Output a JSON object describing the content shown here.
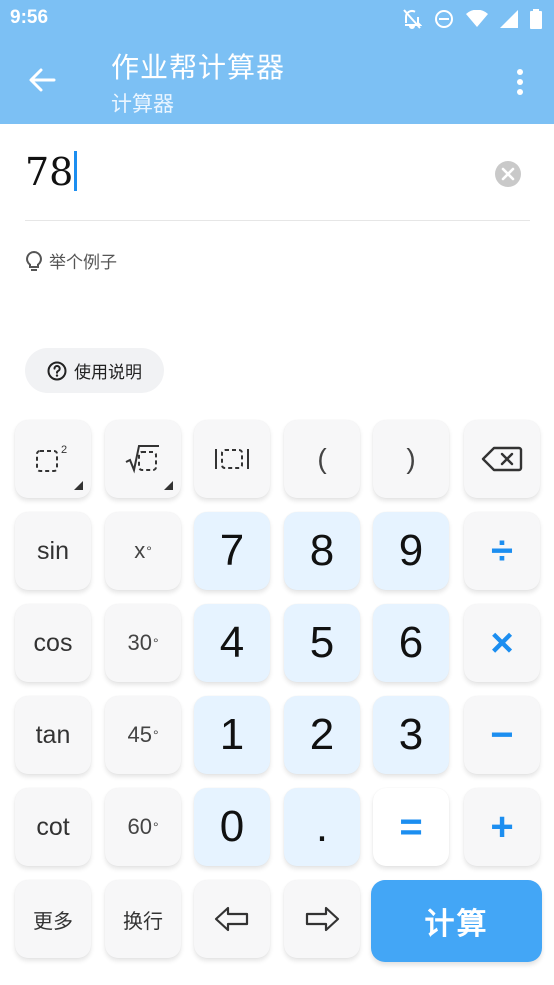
{
  "status": {
    "time": "9:56"
  },
  "appbar": {
    "title": "作业帮计算器",
    "subtitle": "计算器"
  },
  "input": {
    "value": "78"
  },
  "example_label": "举个例子",
  "help_label": "使用说明",
  "keys": {
    "sin": "sin",
    "cos": "cos",
    "tan": "tan",
    "cot": "cot",
    "x_deg": "x",
    "d30": "30",
    "d45": "45",
    "d60": "60",
    "n7": "7",
    "n8": "8",
    "n9": "9",
    "n4": "4",
    "n5": "5",
    "n6": "6",
    "n1": "1",
    "n2": "2",
    "n3": "3",
    "n0": "0",
    "dot": ".",
    "lparen": "(",
    "rparen": ")",
    "divide": "÷",
    "multiply": "×",
    "minus": "−",
    "plus": "+",
    "equals": "=",
    "more": "更多",
    "newline": "换行",
    "deg_symbol": "°",
    "square_exp": "2"
  },
  "compute_label": "计算",
  "colors": {
    "accent": "#1c8ef0",
    "appbar": "#7cc0f4",
    "compute": "#43a6f6",
    "num_key": "#e6f3ff"
  }
}
